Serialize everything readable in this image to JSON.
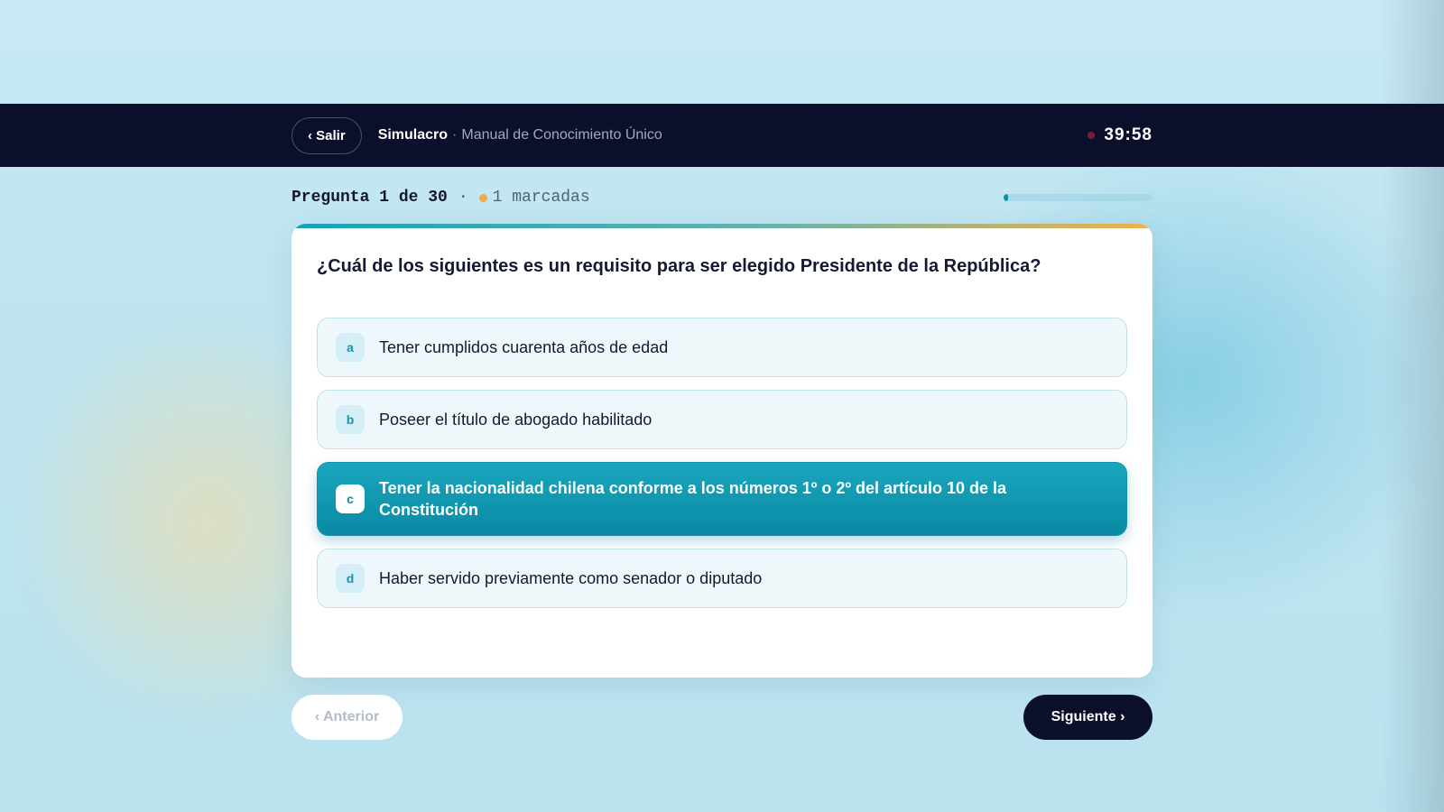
{
  "header": {
    "exit_label": "‹ Salir",
    "mode": "Simulacro",
    "separator": "·",
    "subject": "Manual de Conocimiento Único",
    "timer": "39:58"
  },
  "progress": {
    "counter": "Pregunta 1 de 30",
    "separator": "·",
    "marked": "1 marcadas",
    "fraction": 0.033
  },
  "question": {
    "text": "¿Cuál de los siguientes es un requisito para ser elegido Presidente de la República?",
    "options": [
      {
        "letter": "a",
        "text": "Tener cumplidos cuarenta años de edad",
        "selected": false
      },
      {
        "letter": "b",
        "text": "Poseer el título de abogado habilitado",
        "selected": false
      },
      {
        "letter": "c",
        "text": "Tener la nacionalidad chilena conforme a los números 1º o 2º del artículo 10 de la Constitución",
        "selected": true
      },
      {
        "letter": "d",
        "text": "Haber servido previamente como senador o diputado",
        "selected": false
      }
    ]
  },
  "nav": {
    "prev_label": "‹ Anterior",
    "next_label": "Siguiente ›"
  },
  "colors": {
    "dark": "#0c0f2b",
    "accent": "#0d8fa8",
    "marker": "#f1a94a",
    "recording": "#7a1f33"
  }
}
